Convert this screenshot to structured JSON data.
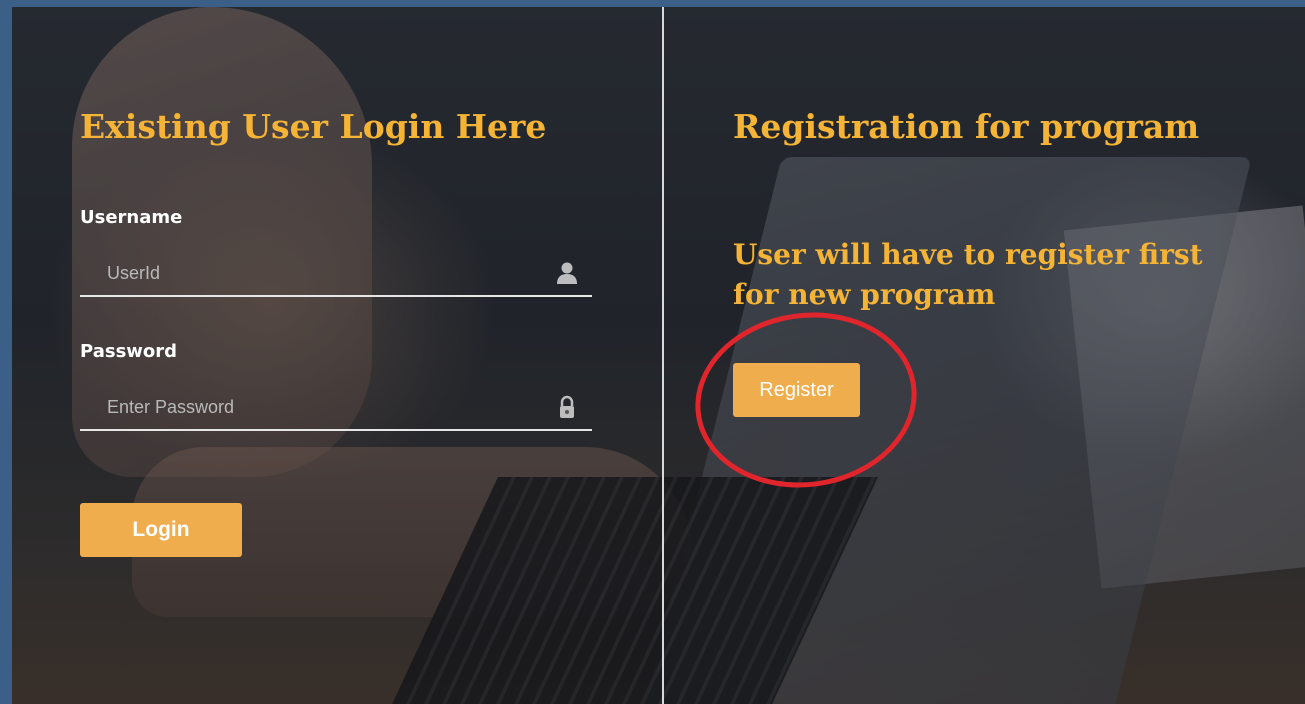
{
  "login": {
    "title": "Existing User Login Here",
    "username_label": "Username",
    "username_placeholder": "UserId",
    "password_label": "Password",
    "password_placeholder": "Enter Password",
    "login_button": "Login"
  },
  "registration": {
    "title": "Registration for program",
    "subtitle": "User will have to register first for new program",
    "register_button": "Register"
  },
  "colors": {
    "accent": "#f0ad4e",
    "title_text": "#f5b435",
    "highlight_circle": "#e0262c"
  },
  "icons": {
    "username": "user-icon",
    "password": "lock-icon"
  }
}
